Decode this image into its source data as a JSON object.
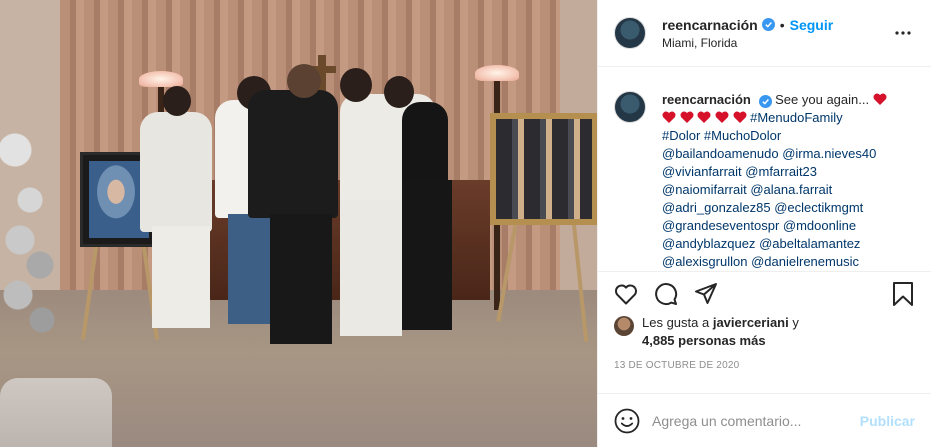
{
  "header": {
    "username": "reencarnación",
    "separator": "•",
    "follow_label": "Seguir",
    "location": "Miami, Florida"
  },
  "caption": {
    "username": "reencarnación",
    "text_start": "See you again...",
    "hashtags": "#MenudoFamily #Dolor #MuchoDolor",
    "hashtag_1": "#MenudoFamily",
    "hashtag_2": "#Dolor",
    "hashtag_3": "#MuchoDolor",
    "mentions": [
      "@bailandoamenudo",
      "@irma.nieves40",
      "@vivianfarrait",
      "@mfarrait23",
      "@naiomifarrait",
      "@alana.farrait",
      "@adri_gonzalez85",
      "@eclectikmgmt",
      "@grandeseventospr",
      "@mdoonline",
      "@andyblazquez",
      "@abeltalamantez",
      "@alexisgrullon",
      "@danielrenemusic"
    ]
  },
  "likes": {
    "prefix": "Les gusta a",
    "liker": "javierceriani",
    "suffix": "y",
    "count_text": "4,885 personas más"
  },
  "date": "13 de octubre de 2020",
  "comment": {
    "placeholder": "Agrega un comentario...",
    "publish_label": "Publicar"
  },
  "colors": {
    "accent": "#0095f6",
    "heart": "#e0245e",
    "link": "#00376b",
    "publish_disabled": "#b2dffc"
  }
}
